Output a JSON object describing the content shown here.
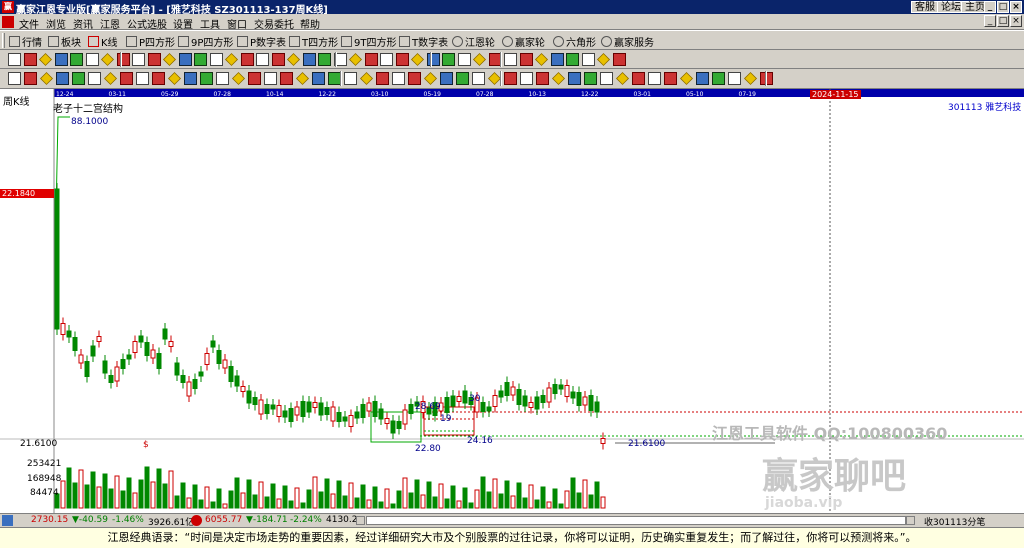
{
  "window": {
    "app_icon": "赢",
    "title": "赢家江恩专业版[赢家服务平台] - [雅艺科技  SZ301113-137周K线]",
    "links": [
      "客服",
      "论坛",
      "主页"
    ],
    "controls": [
      "_",
      "□",
      "×"
    ]
  },
  "menu": {
    "items": [
      "文件",
      "浏览",
      "资讯",
      "江恩",
      "公式选股",
      "设置",
      "工具",
      "窗口",
      "交易委托",
      "帮助"
    ],
    "mdi_controls": [
      "_",
      "□",
      "×"
    ]
  },
  "toolbar1": {
    "items": [
      "行情",
      "板块",
      "K线",
      "P四方形",
      "9P四方形",
      "P数字表",
      "T四方形",
      "9T四方形",
      "T数字表",
      "江恩轮",
      "赢家轮",
      "六角形",
      "赢家服务"
    ]
  },
  "chart": {
    "period_label": "周K线",
    "indicator_title": "老子十二宫结构",
    "stock_label": "301113 雅艺科技",
    "price_tag": "22.1840",
    "date_ticks": [
      "12-24",
      "03-11",
      "05-29",
      "07-28",
      "10-14",
      "12-22",
      "03-10",
      "05-19",
      "07-28",
      "10-13",
      "12-22",
      "03-01",
      "05-10",
      "07-19"
    ],
    "cursor_date": "2024-11-15",
    "annotations": {
      "high": "88.1000",
      "low_current": "21.6100",
      "box1_low": "22.80",
      "box2_top": "28.69",
      "box2_low": "24.16",
      "box2_mid": "19",
      "box3_top": "30"
    },
    "left_axis": {
      "price": "21.6100",
      "marker": "$",
      "volumes": [
        "253421",
        "168948",
        "84474"
      ]
    },
    "watermark_text": "江恩工具软件  QQ:100800360",
    "watermark_brand": "赢家聊吧",
    "watermark_url": "jiaoba.vip"
  },
  "chart_data": {
    "type": "candlestick",
    "period": "weekly",
    "title": "老子十二宫结构",
    "series": [
      {
        "name": "price",
        "high": 88.1,
        "low": 21.61,
        "current": 21.61
      }
    ],
    "volume_ticks": [
      253421,
      168948,
      84474
    ]
  },
  "status": {
    "index1": {
      "value": "2730.15",
      "change": "▼-40.59",
      "pct": "-1.46%",
      "amount": "3926.61亿"
    },
    "index2": {
      "value": "6055.77",
      "change": "▼-184.71",
      "pct": "-2.24%",
      "amount": "4130.2"
    },
    "right": "收301113分笔"
  },
  "quote_text": "江恩经典语录：“时间是决定市场走势的重要因素，经过详细研究大市及个别股票的过往记录，你将可以证明，历史确实重复发生；而了解过往，你将可以预测将来。”。"
}
